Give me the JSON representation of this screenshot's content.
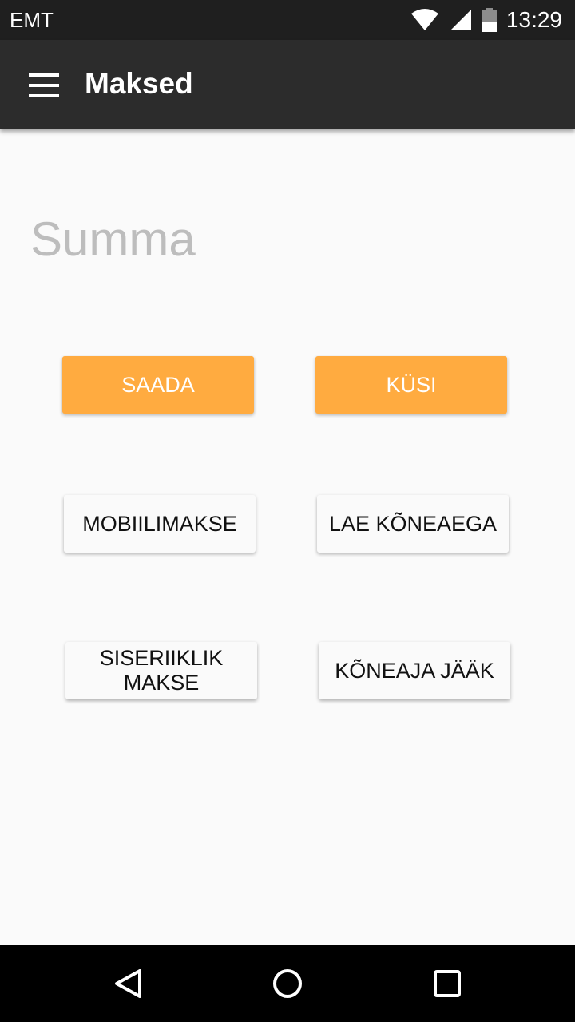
{
  "status_bar": {
    "carrier": "EMT",
    "time": "13:29",
    "icons": [
      "wifi-icon",
      "cellular-signal-icon",
      "battery-icon"
    ]
  },
  "app_bar": {
    "title": "Maksed",
    "menu_icon": "hamburger-menu-icon"
  },
  "amount": {
    "placeholder": "Summa",
    "value": ""
  },
  "actions": {
    "send": "SAADA",
    "request": "KÜSI",
    "mobile_payment": "MOBIILIMAKSE",
    "top_up_airtime": "LAE KÕNEAEGA",
    "domestic_payment": "SISERIIKLIK MAKSE",
    "airtime_balance": "KÕNEAJA JÄÄK"
  },
  "nav_bar": {
    "icons": [
      "back-icon",
      "home-icon",
      "recents-icon"
    ]
  },
  "colors": {
    "accent": "#ffab40",
    "app_bar": "#2c2c2c",
    "status_bar": "#1f1f1f",
    "background": "#fafafa"
  }
}
